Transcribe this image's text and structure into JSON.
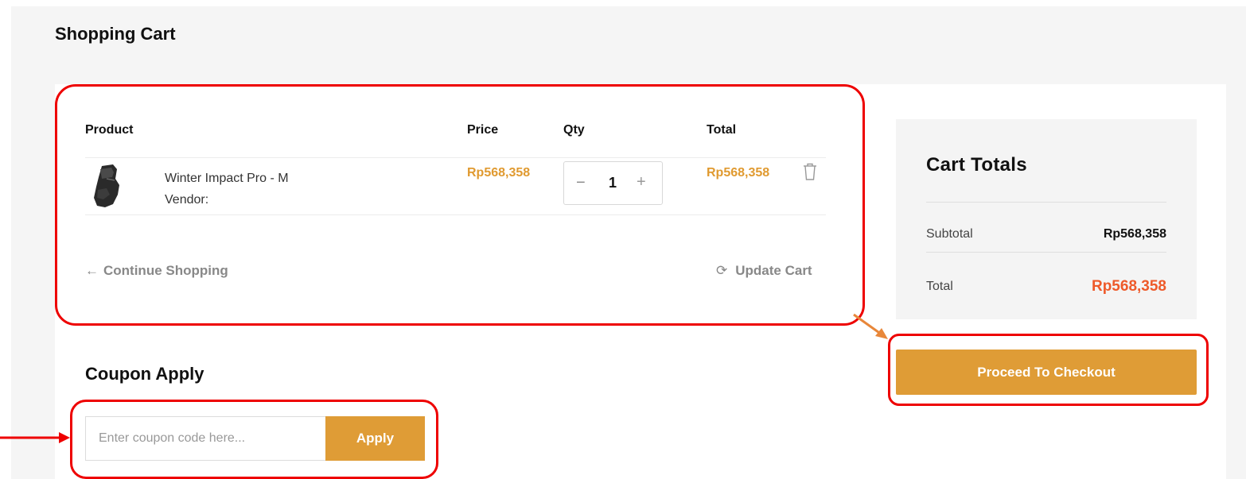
{
  "page": {
    "title": "Shopping Cart"
  },
  "cart": {
    "columns": {
      "product": "Product",
      "price": "Price",
      "qty": "Qty",
      "total": "Total"
    },
    "items": [
      {
        "name": "Winter Impact Pro - M",
        "vendor": "Vendor:",
        "price": "Rp568,358",
        "qty": "1",
        "total": "Rp568,358",
        "thumb_icon": "glove-icon"
      }
    ],
    "qty_minus": "−",
    "qty_plus": "+",
    "continue_arrow": "←",
    "continue_label": "Continue Shopping",
    "update_icon": "⟳",
    "update_label": "Update Cart"
  },
  "coupon": {
    "title": "Coupon Apply",
    "placeholder": "Enter coupon code here...",
    "apply_label": "Apply"
  },
  "totals": {
    "title": "Cart Totals",
    "subtotal_label": "Subtotal",
    "subtotal_value": "Rp568,358",
    "total_label": "Total",
    "total_value": "Rp568,358",
    "checkout_label": "Proceed To Checkout"
  },
  "colors": {
    "accent": "#df9c36",
    "price": "#e09a30",
    "total_highlight": "#ee5a2a",
    "annotation_red": "#ee0000",
    "annotation_orange": "#e8873a"
  }
}
